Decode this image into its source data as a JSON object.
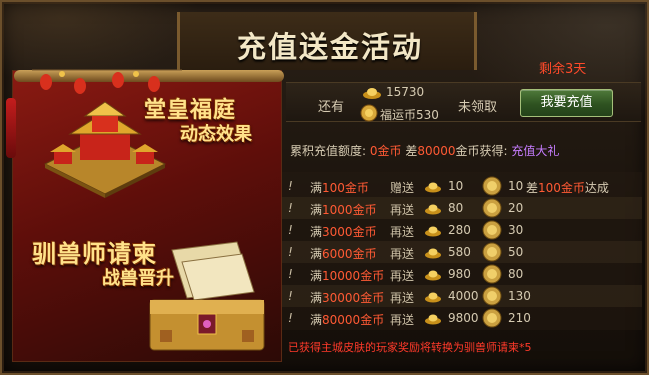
{
  "title": "充值送金活动",
  "remaining_days": "剩余3天",
  "promo": {
    "line1_title": "堂皇福庭",
    "line1_sub": "动态效果",
    "line2_title": "驯兽师请柬",
    "line2_sub": "战兽晋升"
  },
  "status": {
    "have_label": "还有",
    "gold_count": "15730",
    "fuyun_label": "福运币",
    "fuyun_count": "530",
    "unclaimed": "未领取",
    "recharge_button": "我要充值"
  },
  "summary": {
    "label": "累积充值额度:",
    "amount": "0金币",
    "diff_pre": "差",
    "diff_num": "80000",
    "diff_unit": "金币获得:",
    "reward": "充值大礼"
  },
  "tiers": [
    {
      "bang": "!",
      "pre": "满",
      "num": "100",
      "unit": "金币",
      "verb": "赠送",
      "ingots": "10",
      "coins": "10",
      "cond_pre": "差",
      "cond_num": "100金币",
      "cond_post": "达成"
    },
    {
      "bang": "!",
      "pre": "满",
      "num": "1000",
      "unit": "金币",
      "verb": "再送",
      "ingots": "80",
      "coins": "20",
      "cond_pre": "",
      "cond_num": "",
      "cond_post": ""
    },
    {
      "bang": "!",
      "pre": "满",
      "num": "3000",
      "unit": "金币",
      "verb": "再送",
      "ingots": "280",
      "coins": "30",
      "cond_pre": "",
      "cond_num": "",
      "cond_post": ""
    },
    {
      "bang": "!",
      "pre": "满",
      "num": "6000",
      "unit": "金币",
      "verb": "再送",
      "ingots": "580",
      "coins": "50",
      "cond_pre": "",
      "cond_num": "",
      "cond_post": ""
    },
    {
      "bang": "!",
      "pre": "满",
      "num": "10000",
      "unit": "金币",
      "verb": "再送",
      "ingots": "980",
      "coins": "80",
      "cond_pre": "",
      "cond_num": "",
      "cond_post": ""
    },
    {
      "bang": "!",
      "pre": "满",
      "num": "30000",
      "unit": "金币",
      "verb": "再送",
      "ingots": "4000",
      "coins": "130",
      "cond_pre": "",
      "cond_num": "",
      "cond_post": ""
    },
    {
      "bang": "!",
      "pre": "满",
      "num": "80000",
      "unit": "金币",
      "verb": "再送",
      "ingots": "9800",
      "coins": "210",
      "cond_pre": "",
      "cond_num": "",
      "cond_post": ""
    }
  ],
  "footer_note": "已获得主城皮肤的玩家奖励将转换为驯兽师请柬*5",
  "colors": {
    "accent_red": "#ff5a34",
    "reward_purple": "#c77dff",
    "button_green": "#2e5220",
    "gold": "#ffe28a"
  },
  "icons": [
    "gold-ingot-icon",
    "fuyun-coin-icon",
    "palace-illustration",
    "chest-illustration",
    "lantern-illustration"
  ]
}
